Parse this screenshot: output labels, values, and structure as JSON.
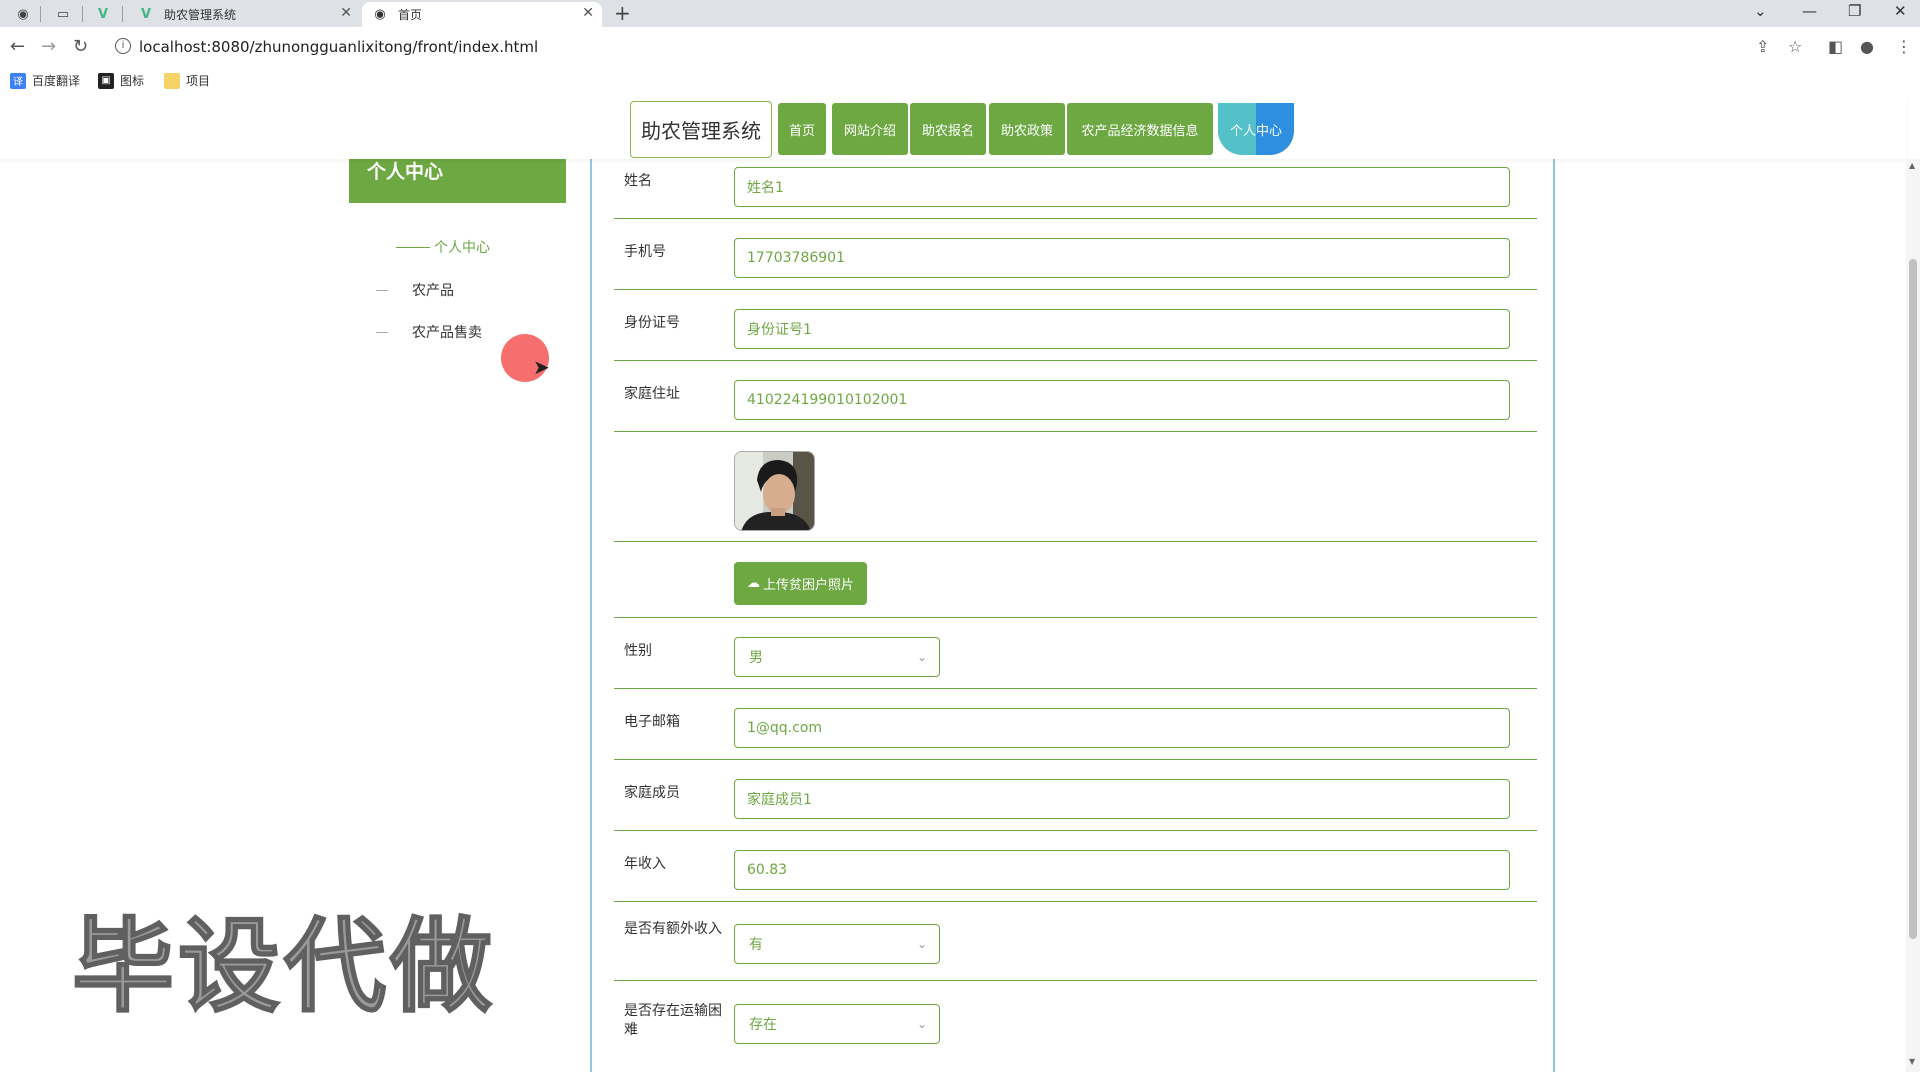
{
  "browser": {
    "tabs": [
      {
        "title": "助农管理系统",
        "active": false
      },
      {
        "title": "首页",
        "active": true
      }
    ],
    "url": "localhost:8080/zhunongguanlixitong/front/index.html",
    "bookmarks": [
      "百度翻译",
      "图标",
      "项目"
    ]
  },
  "nav": {
    "site_title": "助农管理系统",
    "items": [
      "首页",
      "网站介绍",
      "助农报名",
      "助农政策",
      "农产品经济数据信息"
    ],
    "active_item": "个人中心"
  },
  "sidebar": {
    "heading": "个人中心",
    "current": "个人中心",
    "items": [
      "农产品",
      "农产品售卖"
    ]
  },
  "form": {
    "name_label": "姓名",
    "name_value": "姓名1",
    "phone_label": "手机号",
    "phone_value": "17703786901",
    "idcard_label": "身份证号",
    "idcard_value": "身份证号1",
    "address_label": "家庭住址",
    "address_value": "410224199010102001",
    "upload_label": "上传贫困户照片",
    "gender_label": "性别",
    "gender_value": "男",
    "email_label": "电子邮箱",
    "email_value": "1@qq.com",
    "family_label": "家庭成员",
    "family_value": "家庭成员1",
    "income_label": "年收入",
    "income_value": "60.83",
    "extra_income_label": "是否有额外收入",
    "extra_income_value": "有",
    "transport_label": "是否存在运输困难",
    "transport_value": "存在"
  },
  "watermark": "毕设代做",
  "colors": {
    "accent_green": "#6ea843",
    "active_teal": "#54c0c8",
    "active_blue": "#2e8fe0"
  }
}
